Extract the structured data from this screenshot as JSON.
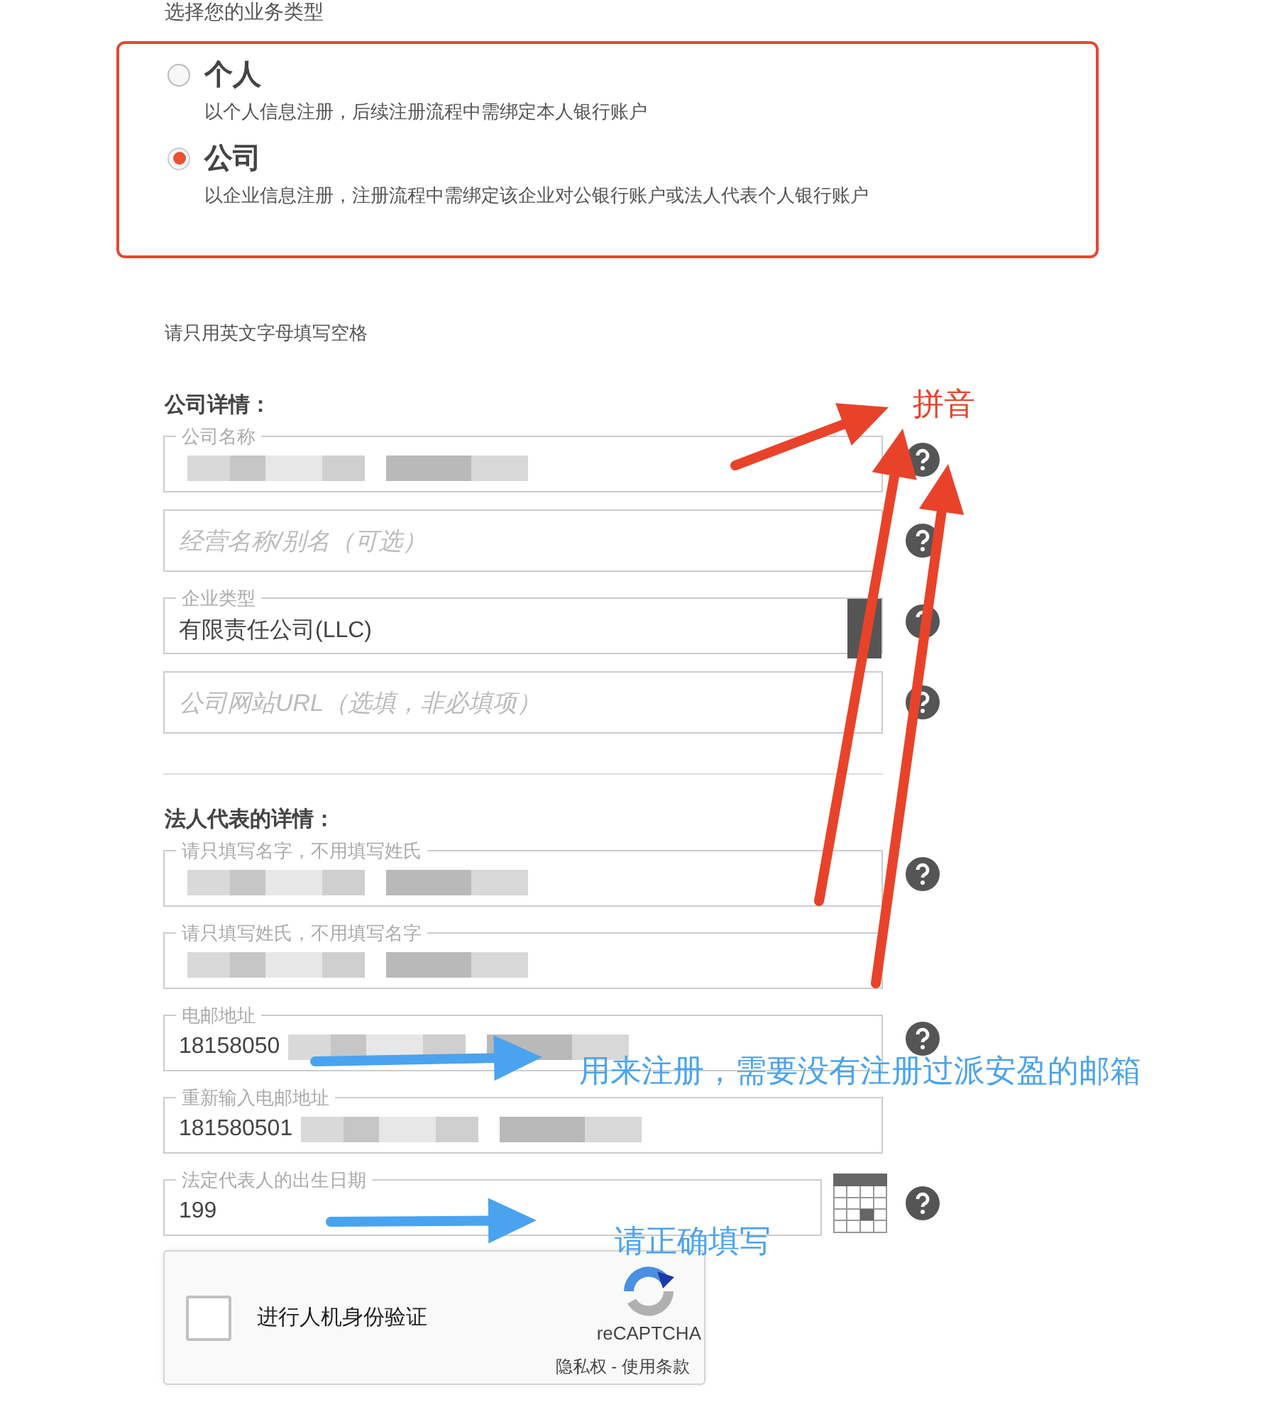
{
  "section_label": "选择您的业务类型",
  "business_types": [
    {
      "title": "个人",
      "description": "以个人信息注册，后续注册流程中需绑定本人银行账户",
      "selected": false
    },
    {
      "title": "公司",
      "description": "以企业信息注册，注册流程中需绑定该企业对公银行账户或法人代表个人银行账户",
      "selected": true
    }
  ],
  "instruction": "请只用英文字母填写空格",
  "company": {
    "heading": "公司详情：",
    "fields": [
      {
        "kind": "text",
        "label": "公司名称",
        "redacted": true,
        "help": true
      },
      {
        "kind": "text",
        "placeholder": "经营名称/别名（可选）",
        "help": true
      },
      {
        "kind": "select",
        "label": "企业类型",
        "value": "有限责任公司(LLC)",
        "help": true
      },
      {
        "kind": "text",
        "placeholder": "公司网站URL（选填，非必填项）",
        "help": true
      }
    ]
  },
  "representative": {
    "heading": "法人代表的详情：",
    "fields": [
      {
        "kind": "text",
        "label": "请只填写名字，不用填写姓氏",
        "redacted": true,
        "help": true
      },
      {
        "kind": "text",
        "label": "请只填写姓氏，不用填写名字",
        "redacted": true,
        "help": false
      },
      {
        "kind": "text",
        "label": "电邮地址",
        "value": "18158050",
        "redacted": true,
        "help": true
      },
      {
        "kind": "text",
        "label": "重新输入电邮地址",
        "value": "181580501",
        "redacted": true,
        "help": false
      },
      {
        "kind": "date",
        "label": "法定代表人的出生日期",
        "value": "199",
        "help": true
      }
    ]
  },
  "captcha": {
    "checked": false,
    "label": "进行人机身份验证",
    "brand": "reCAPTCHA",
    "footer": "隐私权 - 使用条款"
  },
  "annotations": [
    {
      "kind": "red",
      "text": "拼音"
    },
    {
      "kind": "blue",
      "text": "用来注册，需要没有注册过派安盈的邮箱"
    },
    {
      "kind": "blue",
      "text": "请正确填写"
    }
  ]
}
